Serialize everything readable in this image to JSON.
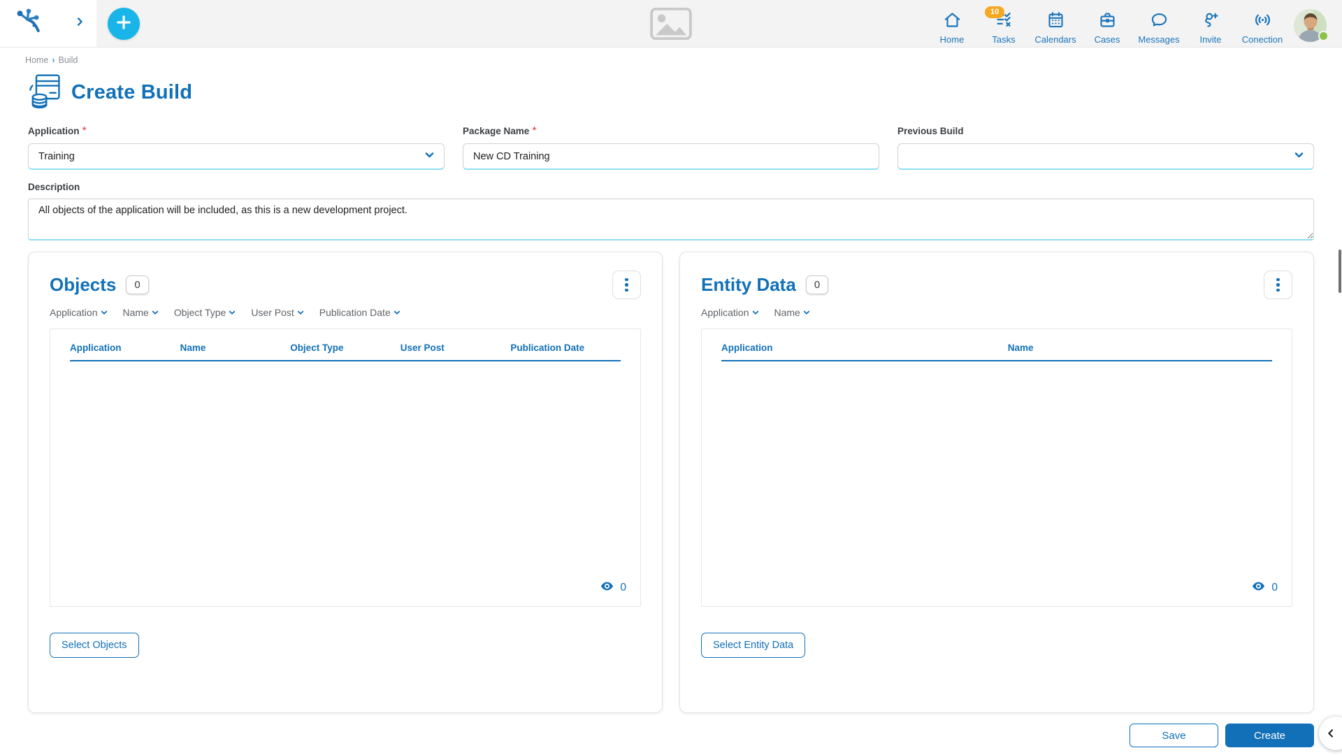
{
  "colors": {
    "primary": "#1170b8",
    "accent_cyan": "#1ab5e8",
    "badge_orange": "#f6a821",
    "status_green": "#8bc34a"
  },
  "header": {
    "nav": [
      {
        "label": "Home"
      },
      {
        "label": "Tasks",
        "badge": "10"
      },
      {
        "label": "Calendars"
      },
      {
        "label": "Cases"
      },
      {
        "label": "Messages"
      },
      {
        "label": "Invite"
      },
      {
        "label": "Conection"
      }
    ]
  },
  "breadcrumb": {
    "home": "Home",
    "separator": "›",
    "current": "Build"
  },
  "page": {
    "title": "Create Build"
  },
  "form": {
    "required_mark": "*",
    "application": {
      "label": "Application",
      "value": "Training"
    },
    "package_name": {
      "label": "Package Name",
      "value": "New CD Training"
    },
    "previous_build": {
      "label": "Previous Build",
      "value": ""
    },
    "description": {
      "label": "Description",
      "value": "All objects of the application will be included, as this is a new development project."
    }
  },
  "objects_panel": {
    "title": "Objects",
    "count": "0",
    "filters": [
      "Application",
      "Name",
      "Object Type",
      "User Post",
      "Publication Date"
    ],
    "columns": [
      "Application",
      "Name",
      "Object Type",
      "User Post",
      "Publication Date"
    ],
    "rows": [],
    "visible_count": "0",
    "select_button": "Select Objects"
  },
  "entity_panel": {
    "title": "Entity Data",
    "count": "0",
    "filters": [
      "Application",
      "Name"
    ],
    "columns": [
      "Application",
      "Name"
    ],
    "rows": [],
    "visible_count": "0",
    "select_button": "Select Entity Data"
  },
  "actions": {
    "save": "Save",
    "create": "Create"
  }
}
